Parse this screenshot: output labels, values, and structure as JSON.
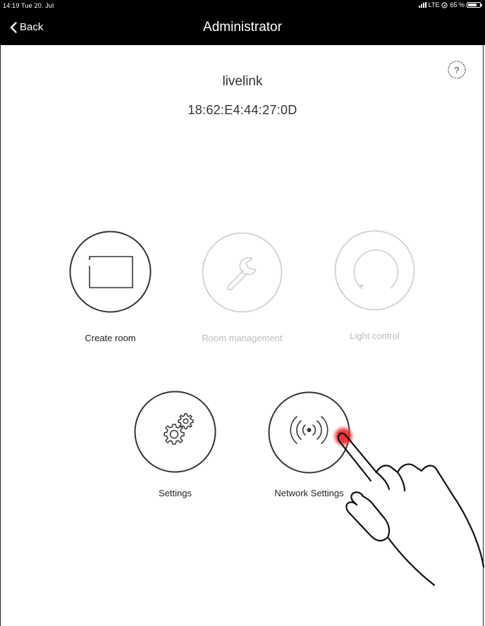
{
  "status_bar": {
    "time_date": "14:19  Tue 20. Jul",
    "network": "LTE",
    "battery": "65 %"
  },
  "nav": {
    "back_label": "Back",
    "title": "Administrator"
  },
  "device": {
    "name": "livelink",
    "mac": "18:62:E4:44:27:0D"
  },
  "help": {
    "icon": "help-icon",
    "glyph": "?"
  },
  "tiles": [
    {
      "label": "Create room",
      "icon": "room-frame-icon",
      "enabled": true
    },
    {
      "label": "Room management",
      "icon": "wrench-icon",
      "enabled": false
    },
    {
      "label": "Light control",
      "icon": "dial-icon",
      "enabled": false
    },
    {
      "label": "Settings",
      "icon": "gears-icon",
      "enabled": true
    },
    {
      "label": "Network Settings",
      "icon": "wireless-signal-icon",
      "enabled": true
    }
  ],
  "colors": {
    "bar_background": "#000000",
    "enabled_stroke": "#333333",
    "disabled_stroke": "#d0d0d0",
    "tap_indicator": "#e02020"
  }
}
